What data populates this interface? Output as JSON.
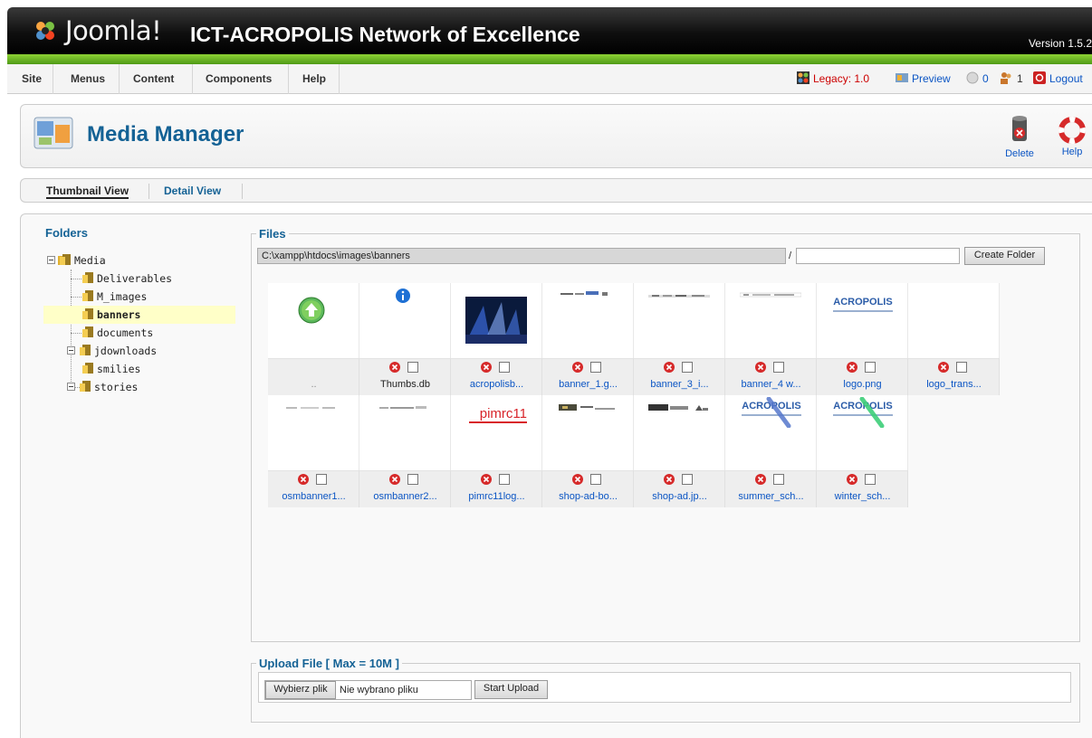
{
  "header": {
    "brand": "Joomla!",
    "site_title": "ICT-ACROPOLIS Network of Excellence",
    "version": "Version 1.5.2"
  },
  "menu": {
    "items": [
      "Site",
      "Menus",
      "Content",
      "Components",
      "Help"
    ],
    "status": {
      "legacy": "Legacy: 1.0",
      "preview": "Preview",
      "messages": "0",
      "users": "1",
      "logout": "Logout"
    }
  },
  "toolbar": {
    "title": "Media Manager",
    "delete_label": "Delete",
    "help_label": "Help"
  },
  "submenu": {
    "thumbnail_view": "Thumbnail View",
    "detail_view": "Detail View"
  },
  "folders": {
    "title": "Folders",
    "root": "Media",
    "items": [
      "Deliverables",
      "M_images",
      "banners",
      "documents",
      "jdownloads",
      "smilies",
      "stories"
    ],
    "selected": "banners"
  },
  "files": {
    "legend": "Files",
    "path": "C:\\xampp\\htdocs\\images\\banners",
    "slash": "/",
    "create_folder_label": "Create Folder",
    "row1": [
      "..",
      "Thumbs.db",
      "acropolisb...",
      "banner_1.g...",
      "banner_3_i...",
      "banner_4 w...",
      "logo.png",
      "logo_trans..."
    ],
    "row2": [
      "osmbanner1...",
      "osmbanner2...",
      "pimrc11log...",
      "shop-ad-bo...",
      "shop-ad.jp...",
      "summer_sch...",
      "winter_sch..."
    ],
    "thumb_texts": {
      "acropolis": "ACROPOLIS",
      "pimrc": "pimrc11"
    }
  },
  "upload": {
    "legend": "Upload File [ Max = 10M ]",
    "choose_label": "Wybierz plik",
    "no_file_text": "Nie wybrano pliku",
    "start_label": "Start Upload"
  },
  "colors": {
    "link": "#0b55c4",
    "title": "#146295",
    "header_green": "#6cb426"
  }
}
